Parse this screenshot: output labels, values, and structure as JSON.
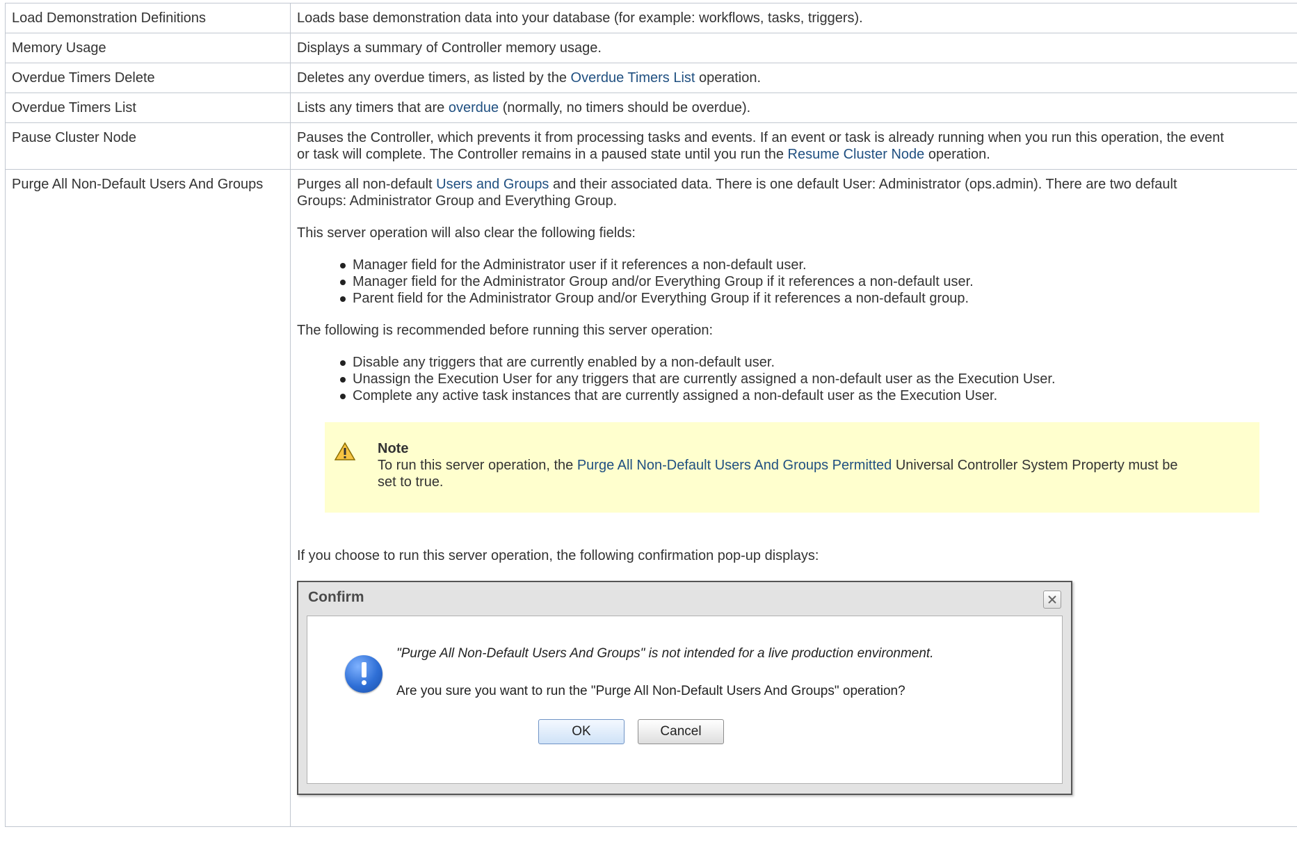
{
  "rows": [
    {
      "name": "Load Demonstration Definitions",
      "desc": "Loads base demonstration data into your database (for example: workflows, tasks, triggers)."
    },
    {
      "name": "Memory Usage",
      "desc": "Displays a summary of Controller memory usage."
    },
    {
      "name": "Overdue Timers Delete",
      "desc_before": "Deletes any overdue timers, as listed by the ",
      "link": "Overdue Timers List",
      "desc_after": " operation."
    },
    {
      "name": "Overdue Timers List",
      "desc_before": "Lists any timers that are ",
      "link": "overdue",
      "desc_after": " (normally, no timers should be overdue)."
    },
    {
      "name": "Pause Cluster Node",
      "desc_line1": "Pauses the Controller, which prevents it from processing tasks and events. If an event or task is already running when you run this operation, the event",
      "desc_before": "or task will complete. The Controller remains in a paused state until you run the ",
      "link": "Resume Cluster Node",
      "desc_after": " operation."
    },
    {
      "name": "Purge All Non-Default Users And Groups",
      "intro_before": "Purges all non-default ",
      "intro_link": "Users and Groups",
      "intro_after_line1": " and their associated data. There is one default User: Administrator (ops.admin). There are two default",
      "intro_line2": "Groups: Administrator Group and Everything Group.",
      "clear_heading": "This server operation will also clear the following fields:",
      "clear_items": [
        "Manager field for the Administrator user if it references a non-default user.",
        "Manager field for the Administrator Group and/or Everything Group if it references a non-default user.",
        "Parent field for the Administrator Group and/or Everything Group if it references a non-default group."
      ],
      "recommend_heading": "The following is recommended before running this server operation:",
      "recommend_items": [
        "Disable any triggers that are currently enabled by a non-default user.",
        "Unassign the Execution User for any triggers that are currently assigned a non-default user as the Execution User.",
        "Complete any active task instances that are currently assigned a non-default user as the Execution User."
      ],
      "note": {
        "title": "Note",
        "before": "To run this server operation, the ",
        "link": "Purge All Non-Default Users And Groups Permitted",
        "after_line1": " Universal Controller System Property must be",
        "line2": "set to true."
      },
      "popup_intro": "If you choose to run this server operation, the following confirmation pop-up displays:",
      "dialog": {
        "title": "Confirm",
        "message1": "\"Purge All Non-Default Users And Groups\" is not intended for a live production environment.",
        "message2": "Are you sure you want to run the \"Purge All Non-Default Users And Groups\" operation?",
        "ok_label": "OK",
        "cancel_label": "Cancel"
      }
    }
  ],
  "colors": {
    "link": "#205081",
    "border": "#c1c7d0",
    "note_bg": "#ffffce"
  }
}
